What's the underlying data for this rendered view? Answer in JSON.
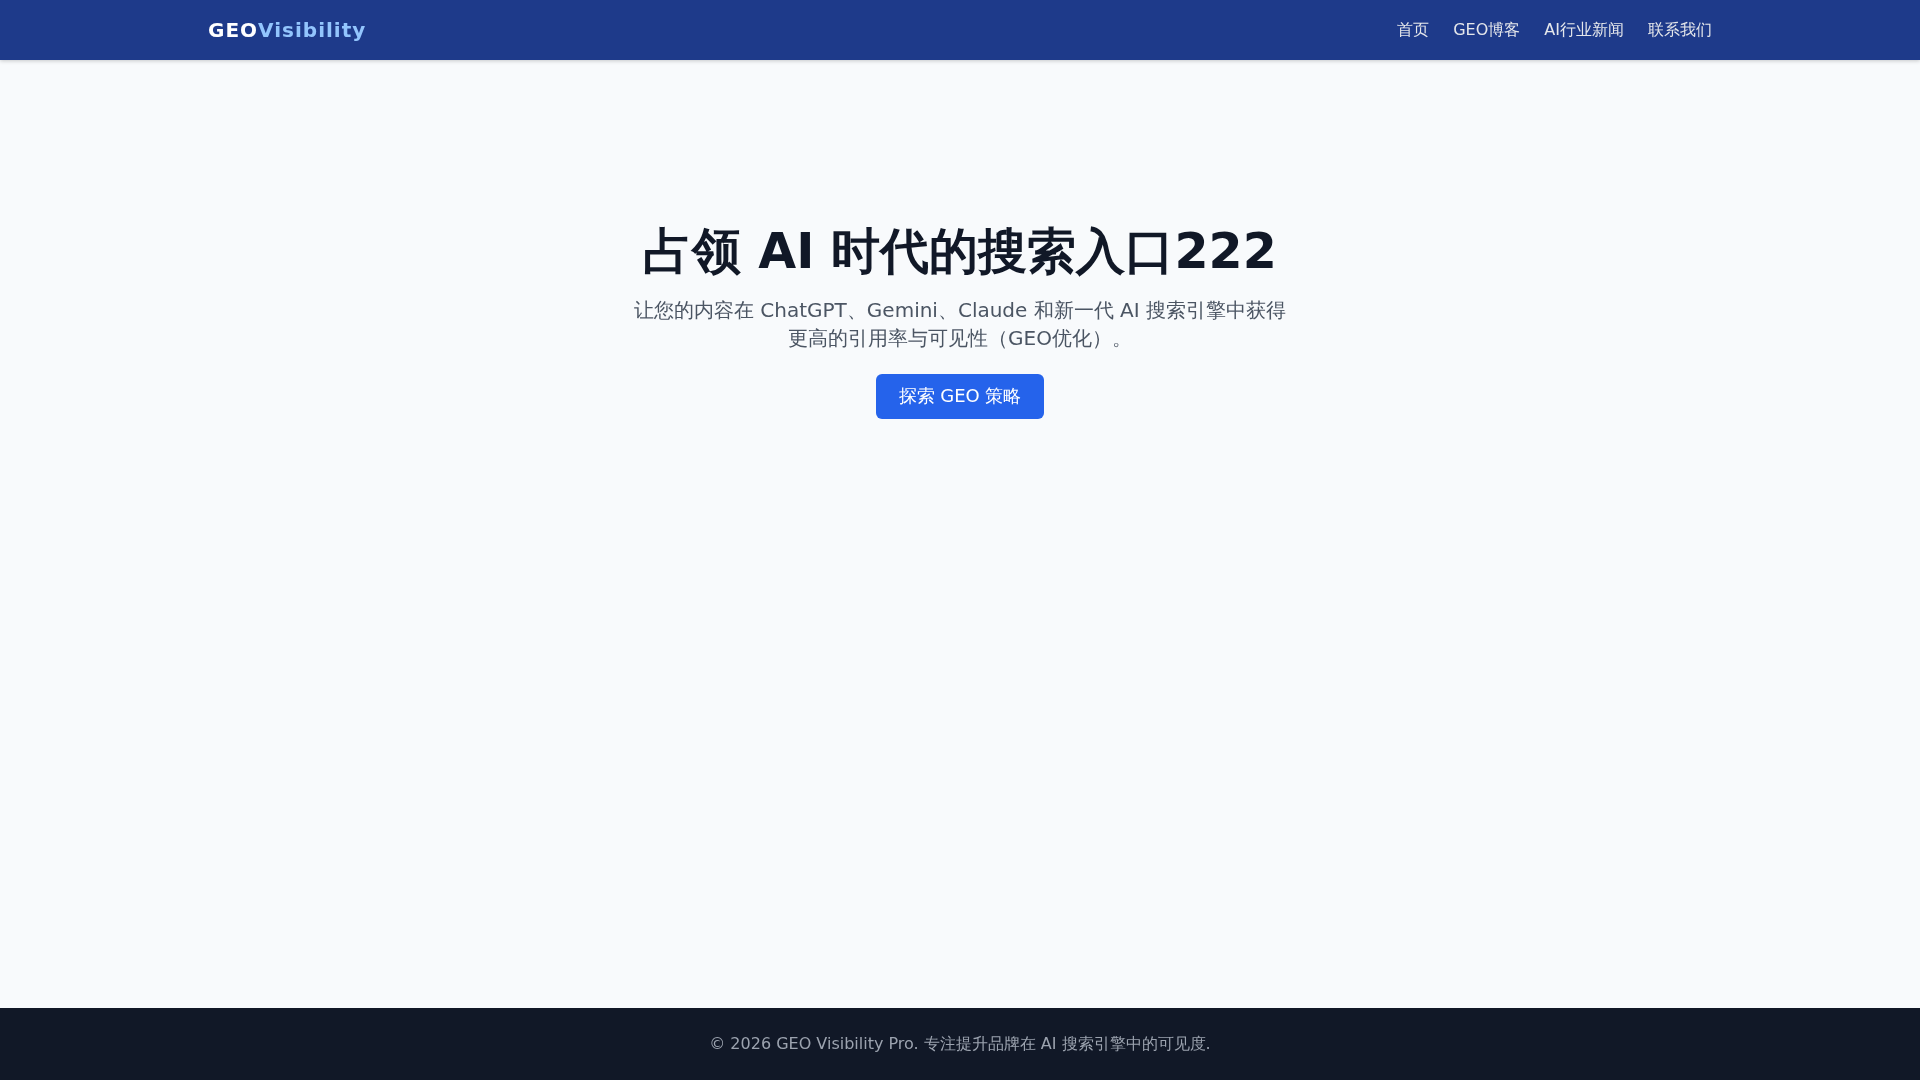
{
  "header": {
    "logo": {
      "prefix": "GEO",
      "suffix": "Visibility"
    },
    "nav": [
      {
        "label": "首页"
      },
      {
        "label": "GEO博客"
      },
      {
        "label": "AI行业新闻"
      },
      {
        "label": "联系我们"
      }
    ]
  },
  "hero": {
    "title": "占领 AI 时代的搜索入口222",
    "subtitle": "让您的内容在 ChatGPT、Gemini、Claude 和新一代 AI 搜索引擎中获得更高的引用率与可见性（GEO优化）。",
    "button": "探索 GEO 策略"
  },
  "footer": {
    "text": "© 2026 GEO Visibility Pro. 专注提升品牌在 AI 搜索引擎中的可见度."
  }
}
